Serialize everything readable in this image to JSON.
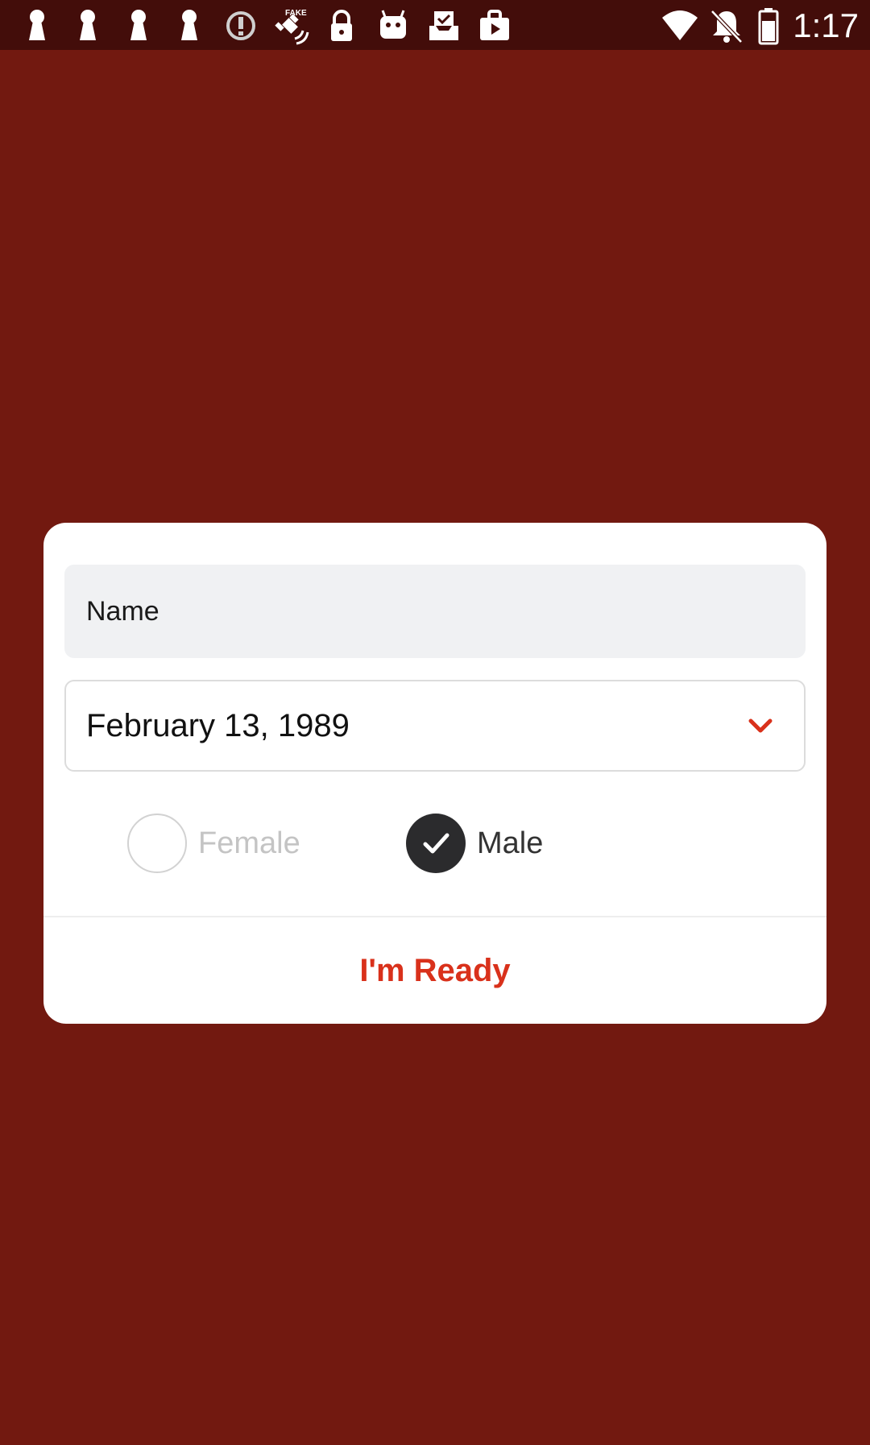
{
  "status_bar": {
    "time": "1:17",
    "left_icons": [
      "keyhole-icon",
      "keyhole-icon",
      "keyhole-icon",
      "keyhole-icon",
      "alert-circle-icon",
      "fake-gps-satellite-icon",
      "lock-icon",
      "android-icon",
      "inbox-check-icon",
      "play-store-icon"
    ],
    "right_icons": [
      "wifi-icon",
      "notifications-off-icon",
      "battery-icon"
    ]
  },
  "dialog": {
    "name_placeholder": "Name",
    "date_value": "February 13, 1989",
    "gender": {
      "female_label": "Female",
      "male_label": "Male",
      "selected": "Male"
    },
    "ready_label": "I'm Ready"
  },
  "colors": {
    "background": "#721910",
    "status_bar": "#430d0a",
    "accent": "#d9311b",
    "radio_selected": "#2b2b2d",
    "input_fill": "#f0f1f3"
  }
}
